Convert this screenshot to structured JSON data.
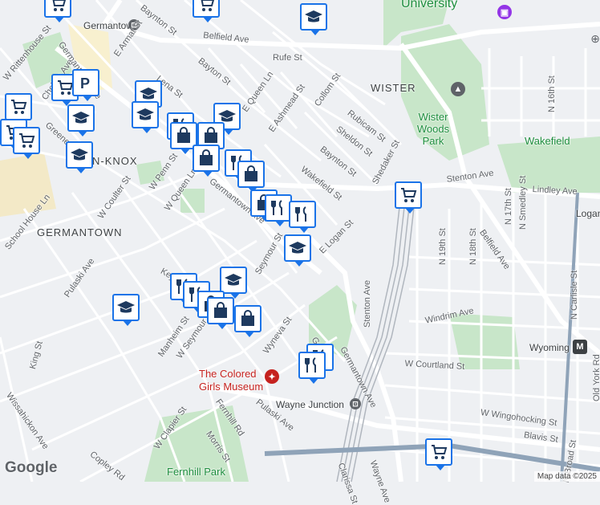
{
  "map": {
    "attribution": "Map data ©2025",
    "brand": "Google",
    "areas": [
      "GERMANTOWN",
      "WISTER",
      "N-KNOX"
    ],
    "parks": [
      "Wister Woods Park",
      "Wakefield",
      "Fernhill Park",
      "University"
    ],
    "places": {
      "museum": "The Colored Girls Museum",
      "germantown_station": "Germantown",
      "wayne_junction": "Wayne Junction",
      "logan": "Logan",
      "wyoming": "Wyoming",
      "metro_badge": "M"
    },
    "streets": [
      "Baynton St",
      "Belfield Ave",
      "Rufe St",
      "E Armat St",
      "Lena St",
      "Bayton St",
      "E Queen Ln",
      "E Ashmead St",
      "Collom St",
      "Rubicam St",
      "Sheldon St",
      "Baynton St",
      "Shedaker St",
      "Wakefield St",
      "E Logan St",
      "Lindley Ave",
      "Belfield Ave",
      "N 16th St",
      "N 17th St",
      "N Smedley St",
      "N 18th St",
      "N 19th St",
      "Windrim Ave",
      "Stenton Ave",
      "W Courtland St",
      "W Wingohocking St",
      "Blavis St",
      "N Broad St",
      "N Carlisle St",
      "Old York Rd",
      "Germantown Ave",
      "W Penn St",
      "W Queen Ln",
      "W Coulter St",
      "School House Ln",
      "Pulaski Ave",
      "W Seymour St",
      "Manheim St",
      "Wyneva St",
      "W Clapier St",
      "Wissahickon Ave",
      "Copley Rd",
      "Morris St",
      "Fernhill Rd",
      "Pulaski Ave",
      "King St",
      "Keyser St",
      "Seymour St",
      "Greene St",
      "W Rittenhouse St",
      "Germantown Ave",
      "Chelten Ave",
      "Clarissa St",
      "Wayne Ave",
      "Germantown Ave",
      "Stenton Ave",
      "Green St"
    ],
    "marker_types": [
      "school-icon",
      "grocery-cart-icon",
      "shopping-bag-icon",
      "restaurant-icon",
      "parking-icon"
    ],
    "colors": {
      "marker_border": "#1a73e8",
      "marker_icon": "#1e3a5f",
      "park_fill": "#c8e6c9",
      "rail": "#9aa0a6"
    }
  }
}
